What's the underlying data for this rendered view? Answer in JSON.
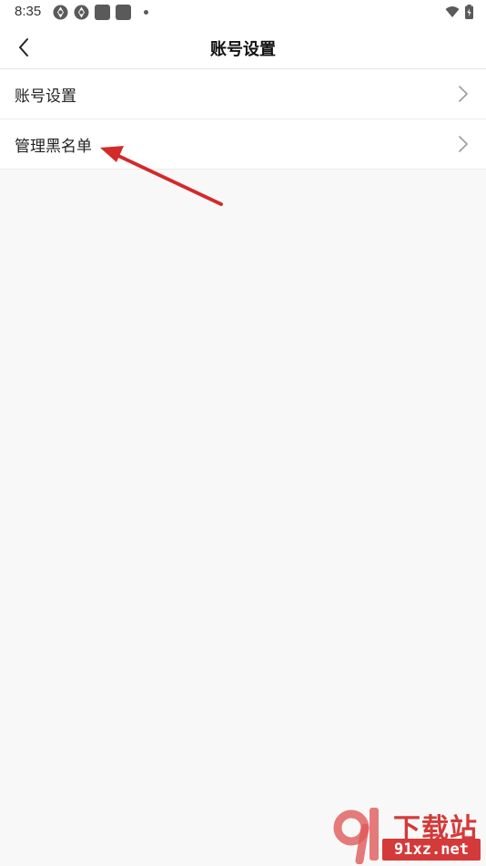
{
  "status_bar": {
    "time": "8:35",
    "left_icons": [
      "aperture-icon",
      "aperture-icon",
      "app-square-icon",
      "app-square-icon",
      "notification-dot-icon"
    ],
    "right_icons": [
      "wifi-icon",
      "battery-charging-icon"
    ]
  },
  "nav": {
    "title": "账号设置",
    "back_icon": "chevron-left-icon"
  },
  "list": {
    "items": [
      {
        "label": "账号设置",
        "icon": "chevron-right-icon"
      },
      {
        "label": "管理黑名单",
        "icon": "chevron-right-icon"
      }
    ]
  },
  "annotation": {
    "color": "#d42a2a",
    "icon": "red-arrow-icon"
  },
  "watermark": {
    "text": "下载站",
    "domain": "91xz.net",
    "color": "#d43a3a"
  },
  "colors": {
    "background": "#f8f8f8",
    "surface": "#ffffff",
    "divider": "#ececec",
    "text": "#222222"
  }
}
